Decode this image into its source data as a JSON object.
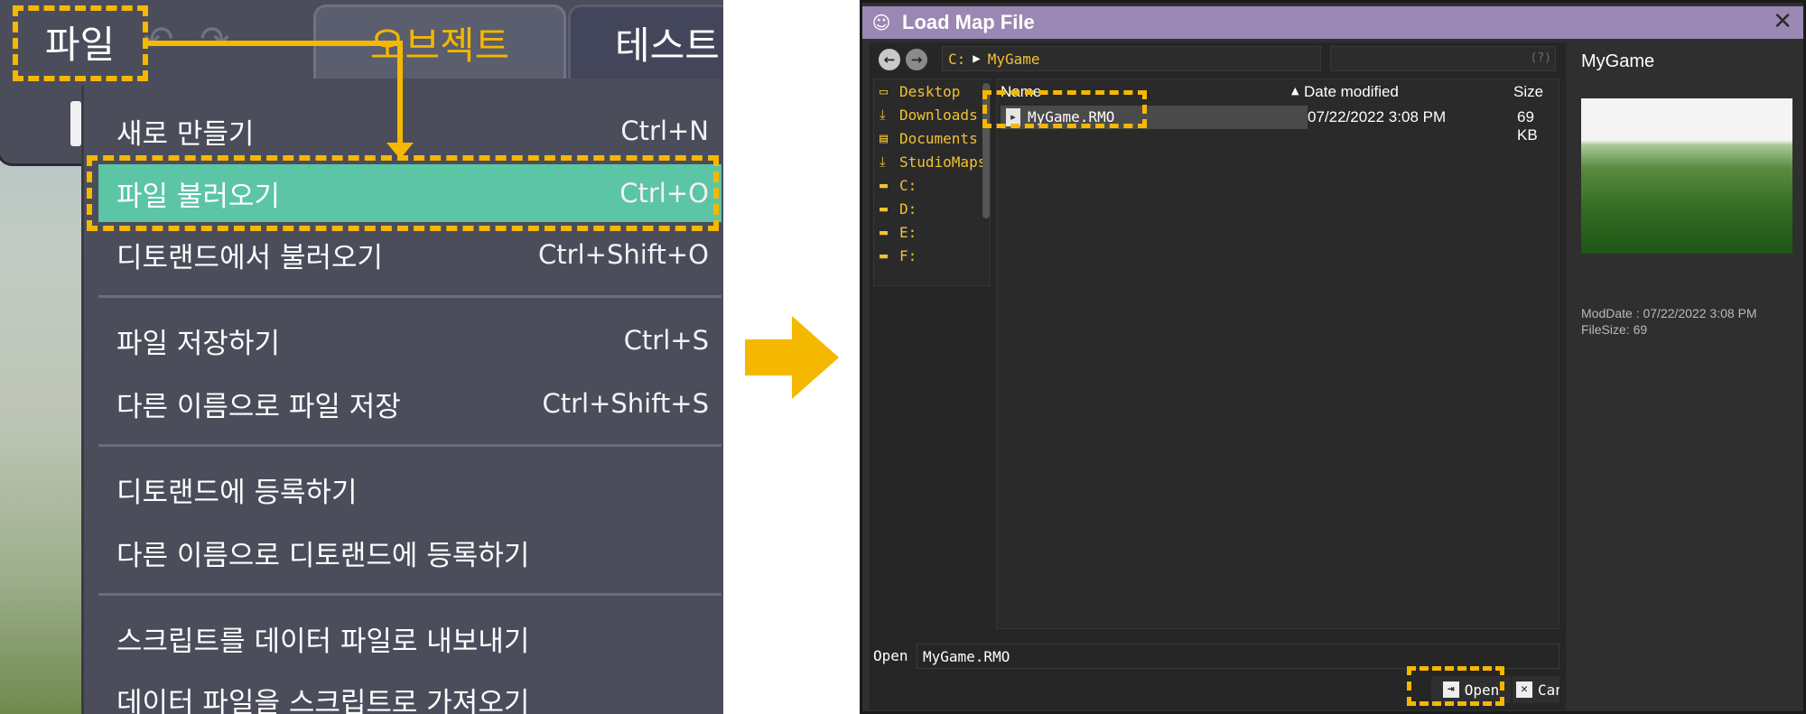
{
  "editor": {
    "tabs": {
      "file": "파일",
      "object": "오브젝트",
      "test": "테스트"
    },
    "menu_items": [
      {
        "label": "새로 만들기",
        "shortcut": "Ctrl+N"
      },
      {
        "label": "파일 불러오기",
        "shortcut": "Ctrl+O"
      },
      {
        "label": "디토랜드에서 불러오기",
        "shortcut": "Ctrl+Shift+O"
      },
      {
        "label": "파일 저장하기",
        "shortcut": "Ctrl+S"
      },
      {
        "label": "다른 이름으로 파일 저장",
        "shortcut": "Ctrl+Shift+S"
      },
      {
        "label": "디토랜드에 등록하기",
        "shortcut": ""
      },
      {
        "label": "다른 이름으로 디토랜드에 등록하기",
        "shortcut": ""
      },
      {
        "label": "스크립트를 데이터 파일로 내보내기",
        "shortcut": ""
      },
      {
        "label": "데이터 파일을 스크립트로 가져오기",
        "shortcut": ""
      }
    ]
  },
  "dialog": {
    "title": "Load Map File",
    "path": {
      "drive": "C:",
      "folder": "MyGame"
    },
    "help": "(?)",
    "places": [
      "Desktop",
      "Downloads",
      "Documents",
      "StudioMaps",
      "C:",
      "D:",
      "E:",
      "F:"
    ],
    "columns": {
      "name": "Name",
      "date": "Date modified",
      "size": "Size"
    },
    "file": {
      "name": "MyGame.RMO",
      "date": "07/22/2022  3:08 PM",
      "size": "69 KB"
    },
    "open_label": "Open",
    "filename_value": "MyGame.RMO",
    "buttons": {
      "open": "Open",
      "cancel": "Cancel"
    },
    "preview": {
      "title": "MyGame",
      "moddate": "ModDate : 07/22/2022  3:08 PM",
      "filesize": "FileSize: 69"
    }
  },
  "colors": {
    "highlight": "#f5b800",
    "menu_selected": "#5cc5a5",
    "menu_bg": "#4b4d5b",
    "dialog_title_bar": "#9a87b3",
    "path_text": "#f1c232"
  }
}
